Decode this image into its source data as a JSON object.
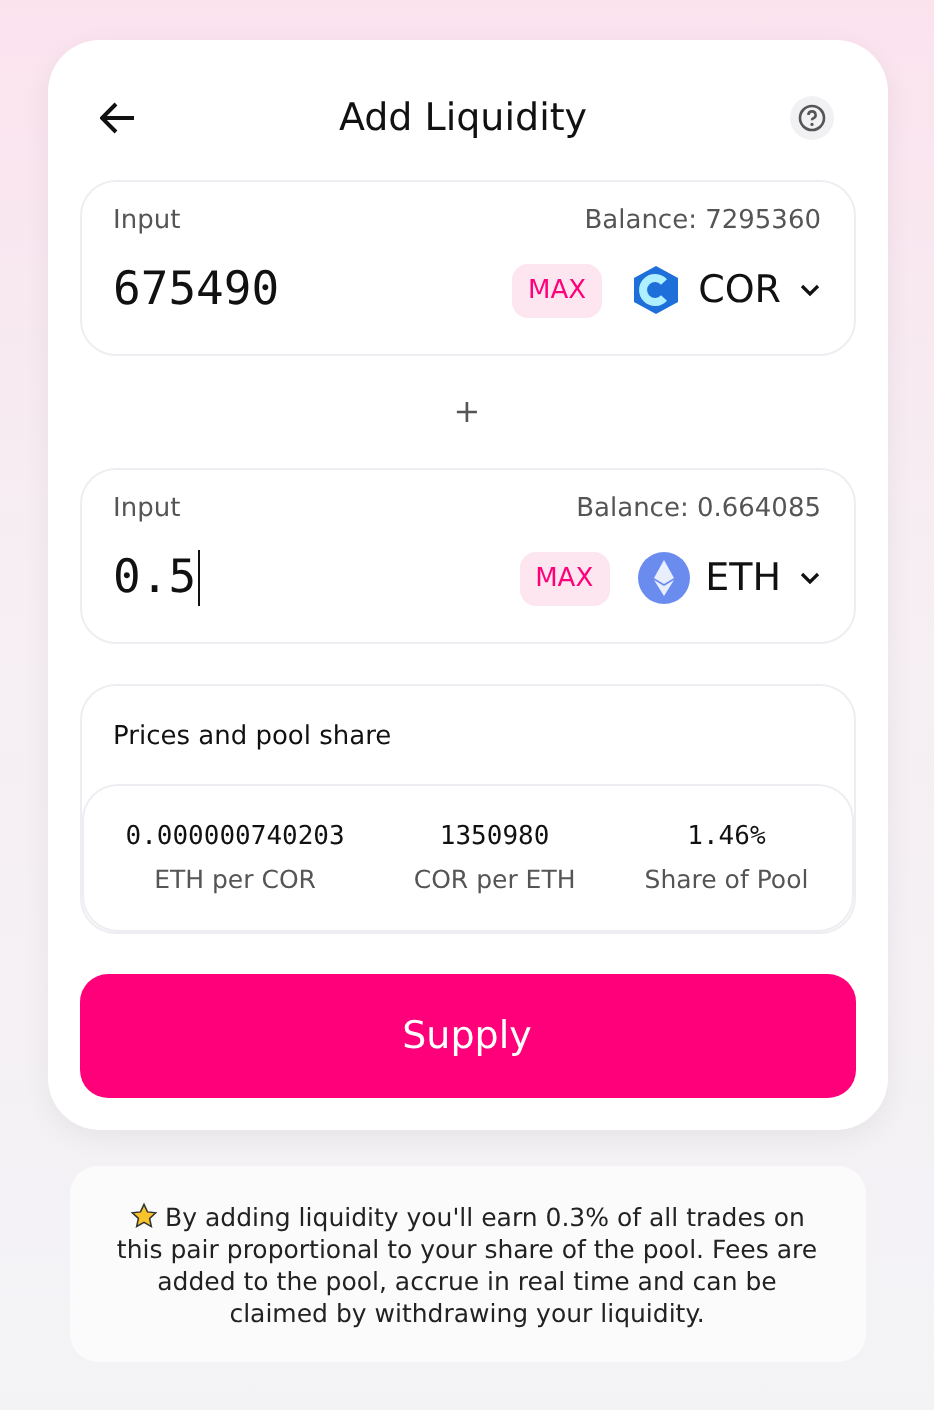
{
  "header": {
    "title": "Add Liquidity"
  },
  "inputs": [
    {
      "label": "Input",
      "balance": "Balance: 7295360",
      "value": "675490",
      "focused": false,
      "max": "MAX",
      "token": {
        "symbol": "COR",
        "kind": "cor"
      }
    },
    {
      "label": "Input",
      "balance": "Balance: 0.664085",
      "value": "0.5",
      "focused": true,
      "max": "MAX",
      "token": {
        "symbol": "ETH",
        "kind": "eth"
      }
    }
  ],
  "separator": "+",
  "prices": {
    "title": "Prices and pool share",
    "stats": [
      {
        "value": "0.000000740203",
        "label": "ETH per COR"
      },
      {
        "value": "1350980",
        "label": "COR per ETH"
      },
      {
        "value": "1.46%",
        "label": "Share of Pool"
      }
    ]
  },
  "supply_button": "Supply",
  "info": "By adding liquidity you'll earn 0.3% of all trades on this pair proportional to your share of the pool. Fees are added to the pool, accrue in real time and can be claimed by withdrawing your liquidity."
}
